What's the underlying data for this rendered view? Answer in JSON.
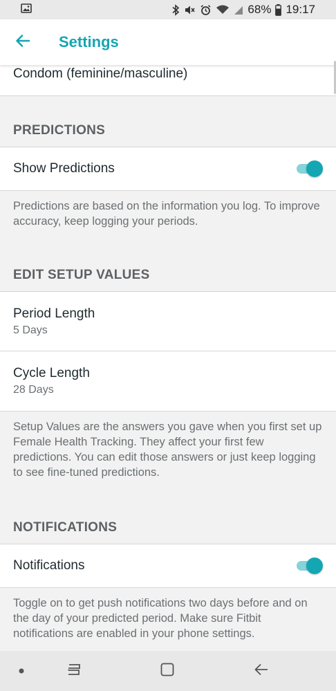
{
  "status_bar": {
    "battery": "68%",
    "time": "19:17",
    "icons": [
      "image-icon",
      "bluetooth-icon",
      "mute-icon",
      "alarm-icon",
      "wifi-icon",
      "signal-icon",
      "battery-icon"
    ]
  },
  "app_bar": {
    "title": "Settings",
    "back_icon": "arrow-left-icon"
  },
  "contraception": {
    "item_label": "Condom (feminine/masculine)"
  },
  "predictions": {
    "header": "PREDICTIONS",
    "toggle_label": "Show Predictions",
    "toggle_on": true,
    "description": "Predictions are based on the information you log. To improve accuracy, keep logging your periods."
  },
  "setup_values": {
    "header": "EDIT SETUP VALUES",
    "items": [
      {
        "label": "Period Length",
        "value": "5 Days"
      },
      {
        "label": "Cycle Length",
        "value": "28 Days"
      }
    ],
    "description": "Setup Values are the answers you gave when you first set up Female Health Tracking. They affect your first few predictions. You can edit those answers or just keep logging to see fine-tuned predictions."
  },
  "notifications": {
    "header": "NOTIFICATIONS",
    "toggle_label": "Notifications",
    "toggle_on": true,
    "description": "Toggle on to get push notifications two days before and on the day of your predicted period. Make sure Fitbit notifications are enabled in your phone settings."
  },
  "colors": {
    "accent": "#16a5b2",
    "toggle_track": "#86d3d9",
    "background": "#f2f2f2"
  },
  "nav_bar": {
    "icons": [
      "dot-icon",
      "recent-apps-icon",
      "home-icon",
      "back-icon"
    ]
  }
}
